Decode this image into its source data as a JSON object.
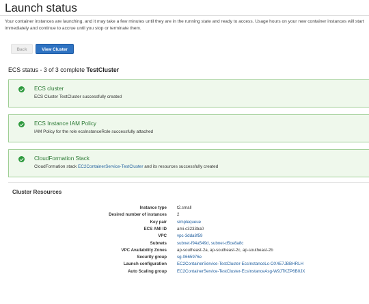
{
  "page": {
    "title": "Launch status",
    "intro": "Your container instances are launching, and it may take a few minutes until they are in the running state and ready to access. Usage hours on your new container instances will start immediately and continue to accrue until you stop or terminate them."
  },
  "buttons": {
    "back": "Back",
    "view_cluster": "View Cluster"
  },
  "status": {
    "prefix": "ECS status - 3 of 3 complete",
    "cluster_name": "TestCluster"
  },
  "steps": [
    {
      "title": "ECS cluster",
      "message": "ECS Cluster TestCluster successfully created",
      "link": "",
      "suffix": ""
    },
    {
      "title": "ECS Instance IAM Policy",
      "message": "IAM Policy for the role ecsInstanceRole successfully attached",
      "link": "",
      "suffix": ""
    },
    {
      "title": "CloudFormation Stack",
      "message": "CloudFormation stack",
      "link": "EC2ContainerService-TestCluster",
      "suffix": "and its resources successfully created"
    }
  ],
  "resources": {
    "title": "Cluster Resources",
    "rows": [
      {
        "label": "Instance type",
        "value": "t2.small",
        "is_link": false
      },
      {
        "label": "Desired number of instances",
        "value": "2",
        "is_link": false
      },
      {
        "label": "Key pair",
        "value": "simplequeue",
        "is_link": true
      },
      {
        "label": "ECS AMI ID",
        "value": "ami-c3233ba0",
        "is_link": false
      },
      {
        "label": "VPC",
        "value": "vpc-3dda8f59",
        "is_link": true
      },
      {
        "label": "Subnets",
        "value": "subnet-f94a549d, subnet-d5ce8a8c",
        "is_link": true
      },
      {
        "label": "VPC Availability Zones",
        "value": "ap-southeast-2a, ap-southeast-2c, ap-southeast-2b",
        "is_link": false
      },
      {
        "label": "Security group",
        "value": "sg-0665976e",
        "is_link": true
      },
      {
        "label": "Launch configuration",
        "value": "EC2ContainerService-TestCluster-EcsInstanceLc-OX4E7JBBHRLH",
        "is_link": true
      },
      {
        "label": "Auto Scaling group",
        "value": "EC2ContainerService-TestCluster-EcsInstanceAsg-W9JTKZP6B0JX",
        "is_link": true
      }
    ]
  },
  "colors": {
    "success_bg": "#eff8ec",
    "success_border": "#9fce95",
    "success_icon": "#2e9a3e",
    "success_title": "#2c7a35",
    "link": "#1f5e9e",
    "primary_button": "#2f73c2"
  },
  "icons": {
    "step_status": "success-check-icon"
  }
}
